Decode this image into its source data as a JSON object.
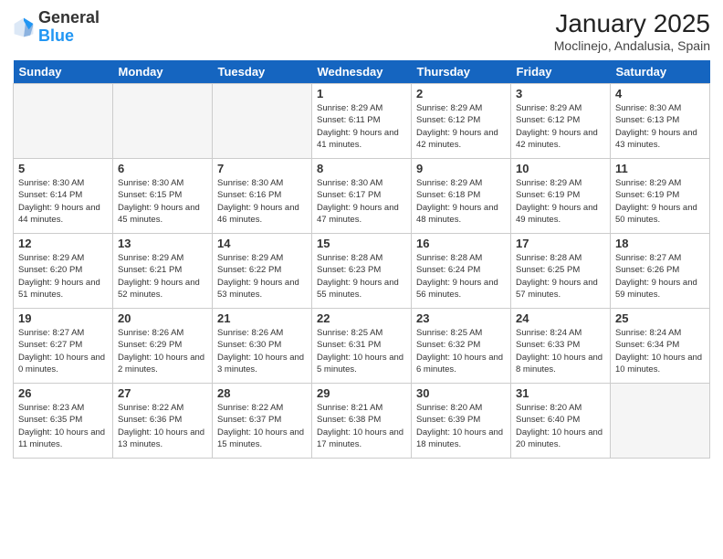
{
  "header": {
    "logo_line1": "General",
    "logo_line2": "Blue",
    "month_title": "January 2025",
    "location": "Moclinejo, Andalusia, Spain"
  },
  "days_of_week": [
    "Sunday",
    "Monday",
    "Tuesday",
    "Wednesday",
    "Thursday",
    "Friday",
    "Saturday"
  ],
  "weeks": [
    [
      {
        "day": "",
        "info": ""
      },
      {
        "day": "",
        "info": ""
      },
      {
        "day": "",
        "info": ""
      },
      {
        "day": "1",
        "info": "Sunrise: 8:29 AM\nSunset: 6:11 PM\nDaylight: 9 hours\nand 41 minutes."
      },
      {
        "day": "2",
        "info": "Sunrise: 8:29 AM\nSunset: 6:12 PM\nDaylight: 9 hours\nand 42 minutes."
      },
      {
        "day": "3",
        "info": "Sunrise: 8:29 AM\nSunset: 6:12 PM\nDaylight: 9 hours\nand 42 minutes."
      },
      {
        "day": "4",
        "info": "Sunrise: 8:30 AM\nSunset: 6:13 PM\nDaylight: 9 hours\nand 43 minutes."
      }
    ],
    [
      {
        "day": "5",
        "info": "Sunrise: 8:30 AM\nSunset: 6:14 PM\nDaylight: 9 hours\nand 44 minutes."
      },
      {
        "day": "6",
        "info": "Sunrise: 8:30 AM\nSunset: 6:15 PM\nDaylight: 9 hours\nand 45 minutes."
      },
      {
        "day": "7",
        "info": "Sunrise: 8:30 AM\nSunset: 6:16 PM\nDaylight: 9 hours\nand 46 minutes."
      },
      {
        "day": "8",
        "info": "Sunrise: 8:30 AM\nSunset: 6:17 PM\nDaylight: 9 hours\nand 47 minutes."
      },
      {
        "day": "9",
        "info": "Sunrise: 8:29 AM\nSunset: 6:18 PM\nDaylight: 9 hours\nand 48 minutes."
      },
      {
        "day": "10",
        "info": "Sunrise: 8:29 AM\nSunset: 6:19 PM\nDaylight: 9 hours\nand 49 minutes."
      },
      {
        "day": "11",
        "info": "Sunrise: 8:29 AM\nSunset: 6:19 PM\nDaylight: 9 hours\nand 50 minutes."
      }
    ],
    [
      {
        "day": "12",
        "info": "Sunrise: 8:29 AM\nSunset: 6:20 PM\nDaylight: 9 hours\nand 51 minutes."
      },
      {
        "day": "13",
        "info": "Sunrise: 8:29 AM\nSunset: 6:21 PM\nDaylight: 9 hours\nand 52 minutes."
      },
      {
        "day": "14",
        "info": "Sunrise: 8:29 AM\nSunset: 6:22 PM\nDaylight: 9 hours\nand 53 minutes."
      },
      {
        "day": "15",
        "info": "Sunrise: 8:28 AM\nSunset: 6:23 PM\nDaylight: 9 hours\nand 55 minutes."
      },
      {
        "day": "16",
        "info": "Sunrise: 8:28 AM\nSunset: 6:24 PM\nDaylight: 9 hours\nand 56 minutes."
      },
      {
        "day": "17",
        "info": "Sunrise: 8:28 AM\nSunset: 6:25 PM\nDaylight: 9 hours\nand 57 minutes."
      },
      {
        "day": "18",
        "info": "Sunrise: 8:27 AM\nSunset: 6:26 PM\nDaylight: 9 hours\nand 59 minutes."
      }
    ],
    [
      {
        "day": "19",
        "info": "Sunrise: 8:27 AM\nSunset: 6:27 PM\nDaylight: 10 hours\nand 0 minutes."
      },
      {
        "day": "20",
        "info": "Sunrise: 8:26 AM\nSunset: 6:29 PM\nDaylight: 10 hours\nand 2 minutes."
      },
      {
        "day": "21",
        "info": "Sunrise: 8:26 AM\nSunset: 6:30 PM\nDaylight: 10 hours\nand 3 minutes."
      },
      {
        "day": "22",
        "info": "Sunrise: 8:25 AM\nSunset: 6:31 PM\nDaylight: 10 hours\nand 5 minutes."
      },
      {
        "day": "23",
        "info": "Sunrise: 8:25 AM\nSunset: 6:32 PM\nDaylight: 10 hours\nand 6 minutes."
      },
      {
        "day": "24",
        "info": "Sunrise: 8:24 AM\nSunset: 6:33 PM\nDaylight: 10 hours\nand 8 minutes."
      },
      {
        "day": "25",
        "info": "Sunrise: 8:24 AM\nSunset: 6:34 PM\nDaylight: 10 hours\nand 10 minutes."
      }
    ],
    [
      {
        "day": "26",
        "info": "Sunrise: 8:23 AM\nSunset: 6:35 PM\nDaylight: 10 hours\nand 11 minutes."
      },
      {
        "day": "27",
        "info": "Sunrise: 8:22 AM\nSunset: 6:36 PM\nDaylight: 10 hours\nand 13 minutes."
      },
      {
        "day": "28",
        "info": "Sunrise: 8:22 AM\nSunset: 6:37 PM\nDaylight: 10 hours\nand 15 minutes."
      },
      {
        "day": "29",
        "info": "Sunrise: 8:21 AM\nSunset: 6:38 PM\nDaylight: 10 hours\nand 17 minutes."
      },
      {
        "day": "30",
        "info": "Sunrise: 8:20 AM\nSunset: 6:39 PM\nDaylight: 10 hours\nand 18 minutes."
      },
      {
        "day": "31",
        "info": "Sunrise: 8:20 AM\nSunset: 6:40 PM\nDaylight: 10 hours\nand 20 minutes."
      },
      {
        "day": "",
        "info": ""
      }
    ]
  ]
}
